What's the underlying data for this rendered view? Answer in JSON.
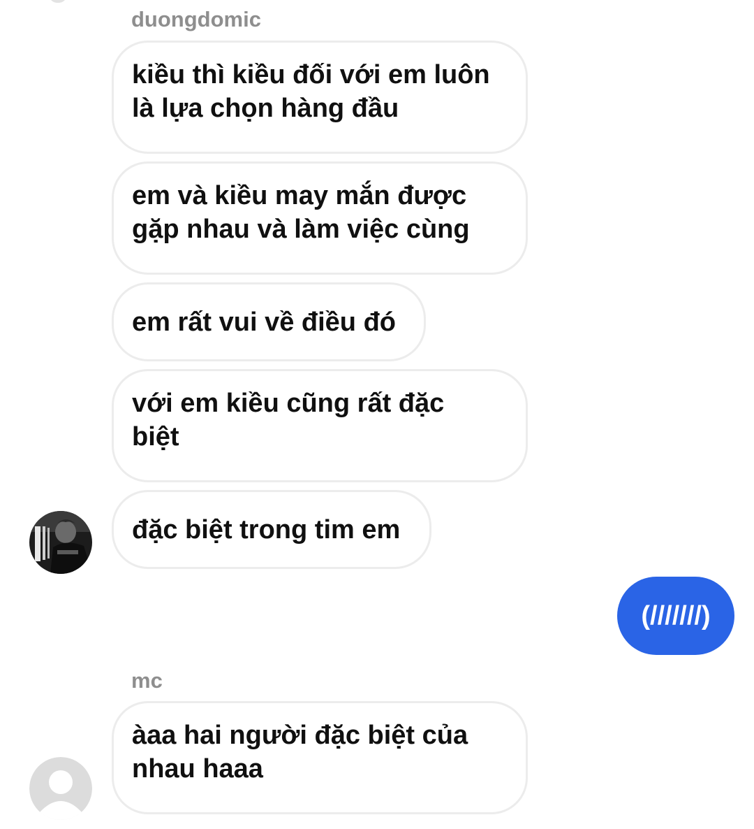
{
  "thread": {
    "groups": [
      {
        "sender": "duongdomic",
        "messages": [
          "kiều thì kiều đối với em luôn\nlà lựa chọn hàng đầu",
          "em và kiều may mắn được\ngặp nhau và làm việc cùng",
          "em rất vui về điều đó",
          "với em kiều cũng rất đặc\nbiệt",
          "đặc biệt trong tim em"
        ],
        "avatar_icon": "user-photo-avatar"
      },
      {
        "sender": "mc",
        "messages": [
          "àaa hai người đặc biệt của\nnhau haaa"
        ],
        "avatar_icon": "default-user-avatar-icon"
      }
    ],
    "outgoing": {
      "text": "(///////)"
    }
  },
  "colors": {
    "outgoing_bubble": "#2a64e6",
    "incoming_border": "#ececec",
    "sender_name": "#8e8e8e",
    "text": "#101010"
  }
}
